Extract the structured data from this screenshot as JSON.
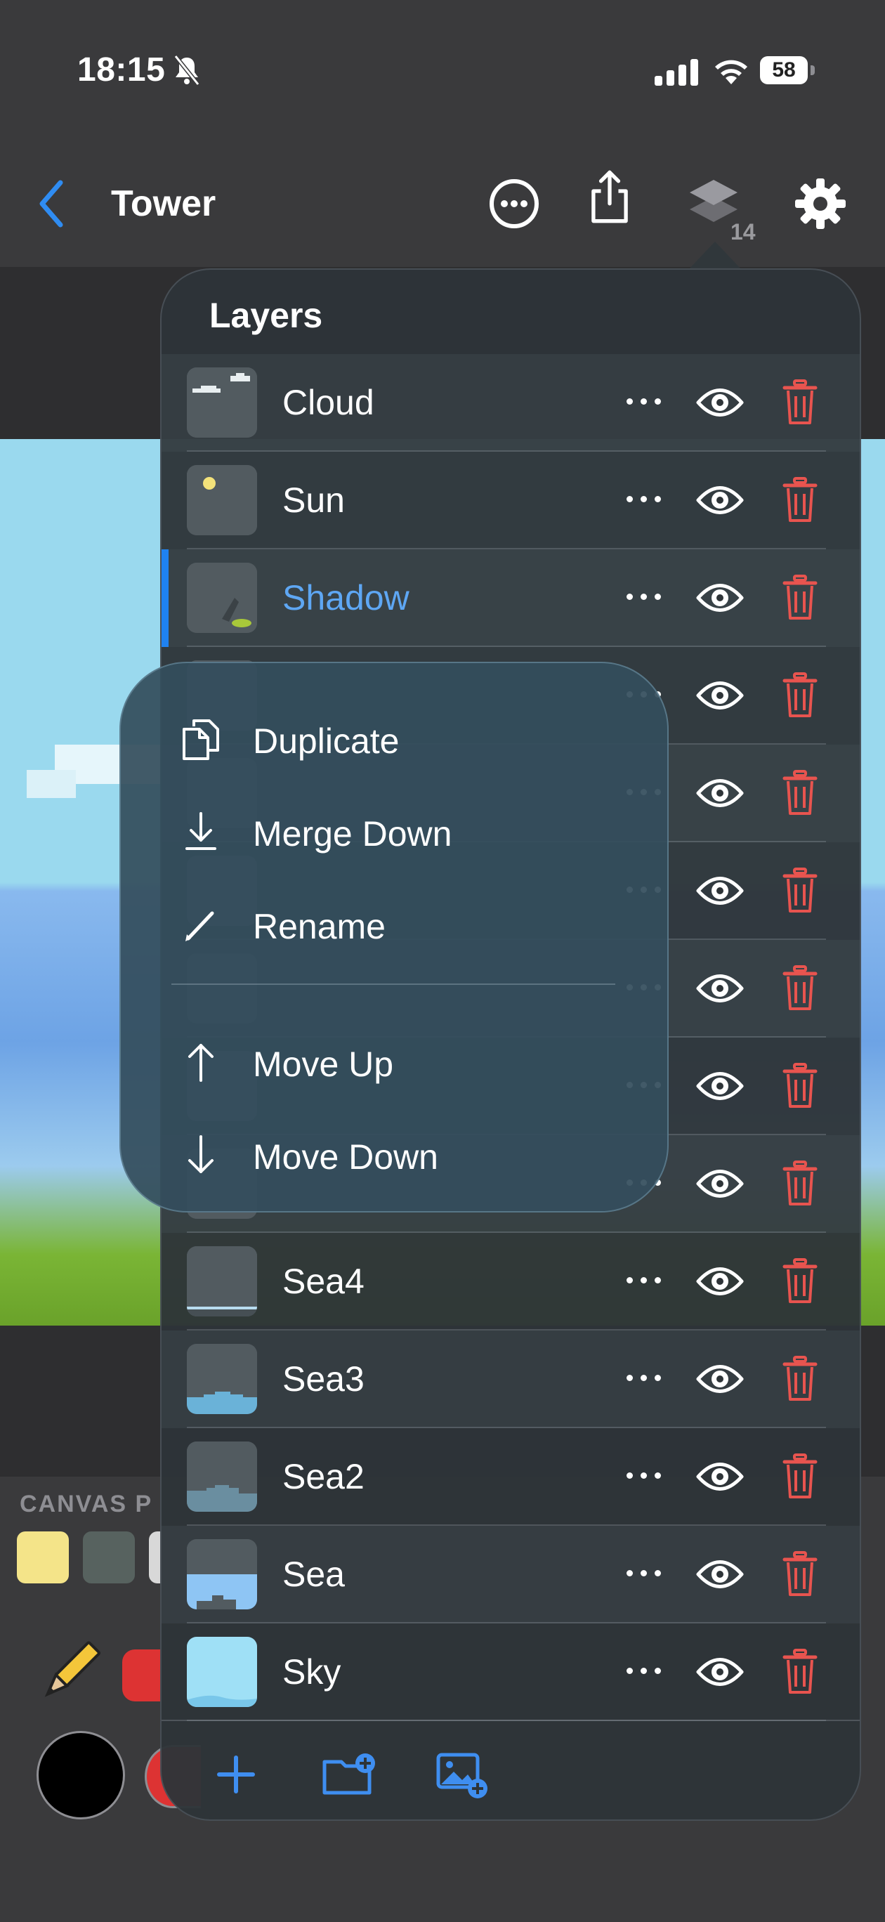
{
  "status_bar": {
    "time": "18:15",
    "battery": "58"
  },
  "nav": {
    "title": "Tower",
    "layers_count": "14"
  },
  "palette": {
    "label": "CANVAS P",
    "swatches": [
      "#f4e489",
      "#57625f",
      "#d8d8d8"
    ]
  },
  "layers_panel": {
    "title": "Layers",
    "layers": [
      {
        "name": "Cloud",
        "selected": false,
        "thumb": "cloud"
      },
      {
        "name": "Sun",
        "selected": false,
        "thumb": "sun"
      },
      {
        "name": "Shadow",
        "selected": true,
        "thumb": "shadow"
      },
      {
        "name": "",
        "selected": false,
        "thumb": "hidden"
      },
      {
        "name": "",
        "selected": false,
        "thumb": "hidden"
      },
      {
        "name": "",
        "selected": false,
        "thumb": "hidden"
      },
      {
        "name": "",
        "selected": false,
        "thumb": "hidden"
      },
      {
        "name": "",
        "selected": false,
        "thumb": "hidden"
      },
      {
        "name": "",
        "selected": false,
        "thumb": "hidden"
      },
      {
        "name": "Sea4",
        "selected": false,
        "thumb": "sea4"
      },
      {
        "name": "Sea3",
        "selected": false,
        "thumb": "sea3"
      },
      {
        "name": "Sea2",
        "selected": false,
        "thumb": "sea2"
      },
      {
        "name": "Sea",
        "selected": false,
        "thumb": "sea"
      },
      {
        "name": "Sky",
        "selected": false,
        "thumb": "sky"
      }
    ],
    "footer_icons": [
      "plus-icon",
      "new-folder-icon",
      "add-image-icon"
    ]
  },
  "context_menu": {
    "items": [
      {
        "label": "Duplicate",
        "icon": "duplicate-icon"
      },
      {
        "label": "Merge Down",
        "icon": "merge-down-icon"
      },
      {
        "label": "Rename",
        "icon": "pencil-icon"
      },
      {
        "label": "Move Up",
        "icon": "arrow-up-icon"
      },
      {
        "label": "Move Down",
        "icon": "arrow-down-icon"
      }
    ]
  },
  "colors": {
    "accent": "#1f82f0",
    "selected_text": "#5ea7f4",
    "delete": "#e8544f",
    "primary_color": "#000000",
    "secondary_color": "#dd3333"
  }
}
